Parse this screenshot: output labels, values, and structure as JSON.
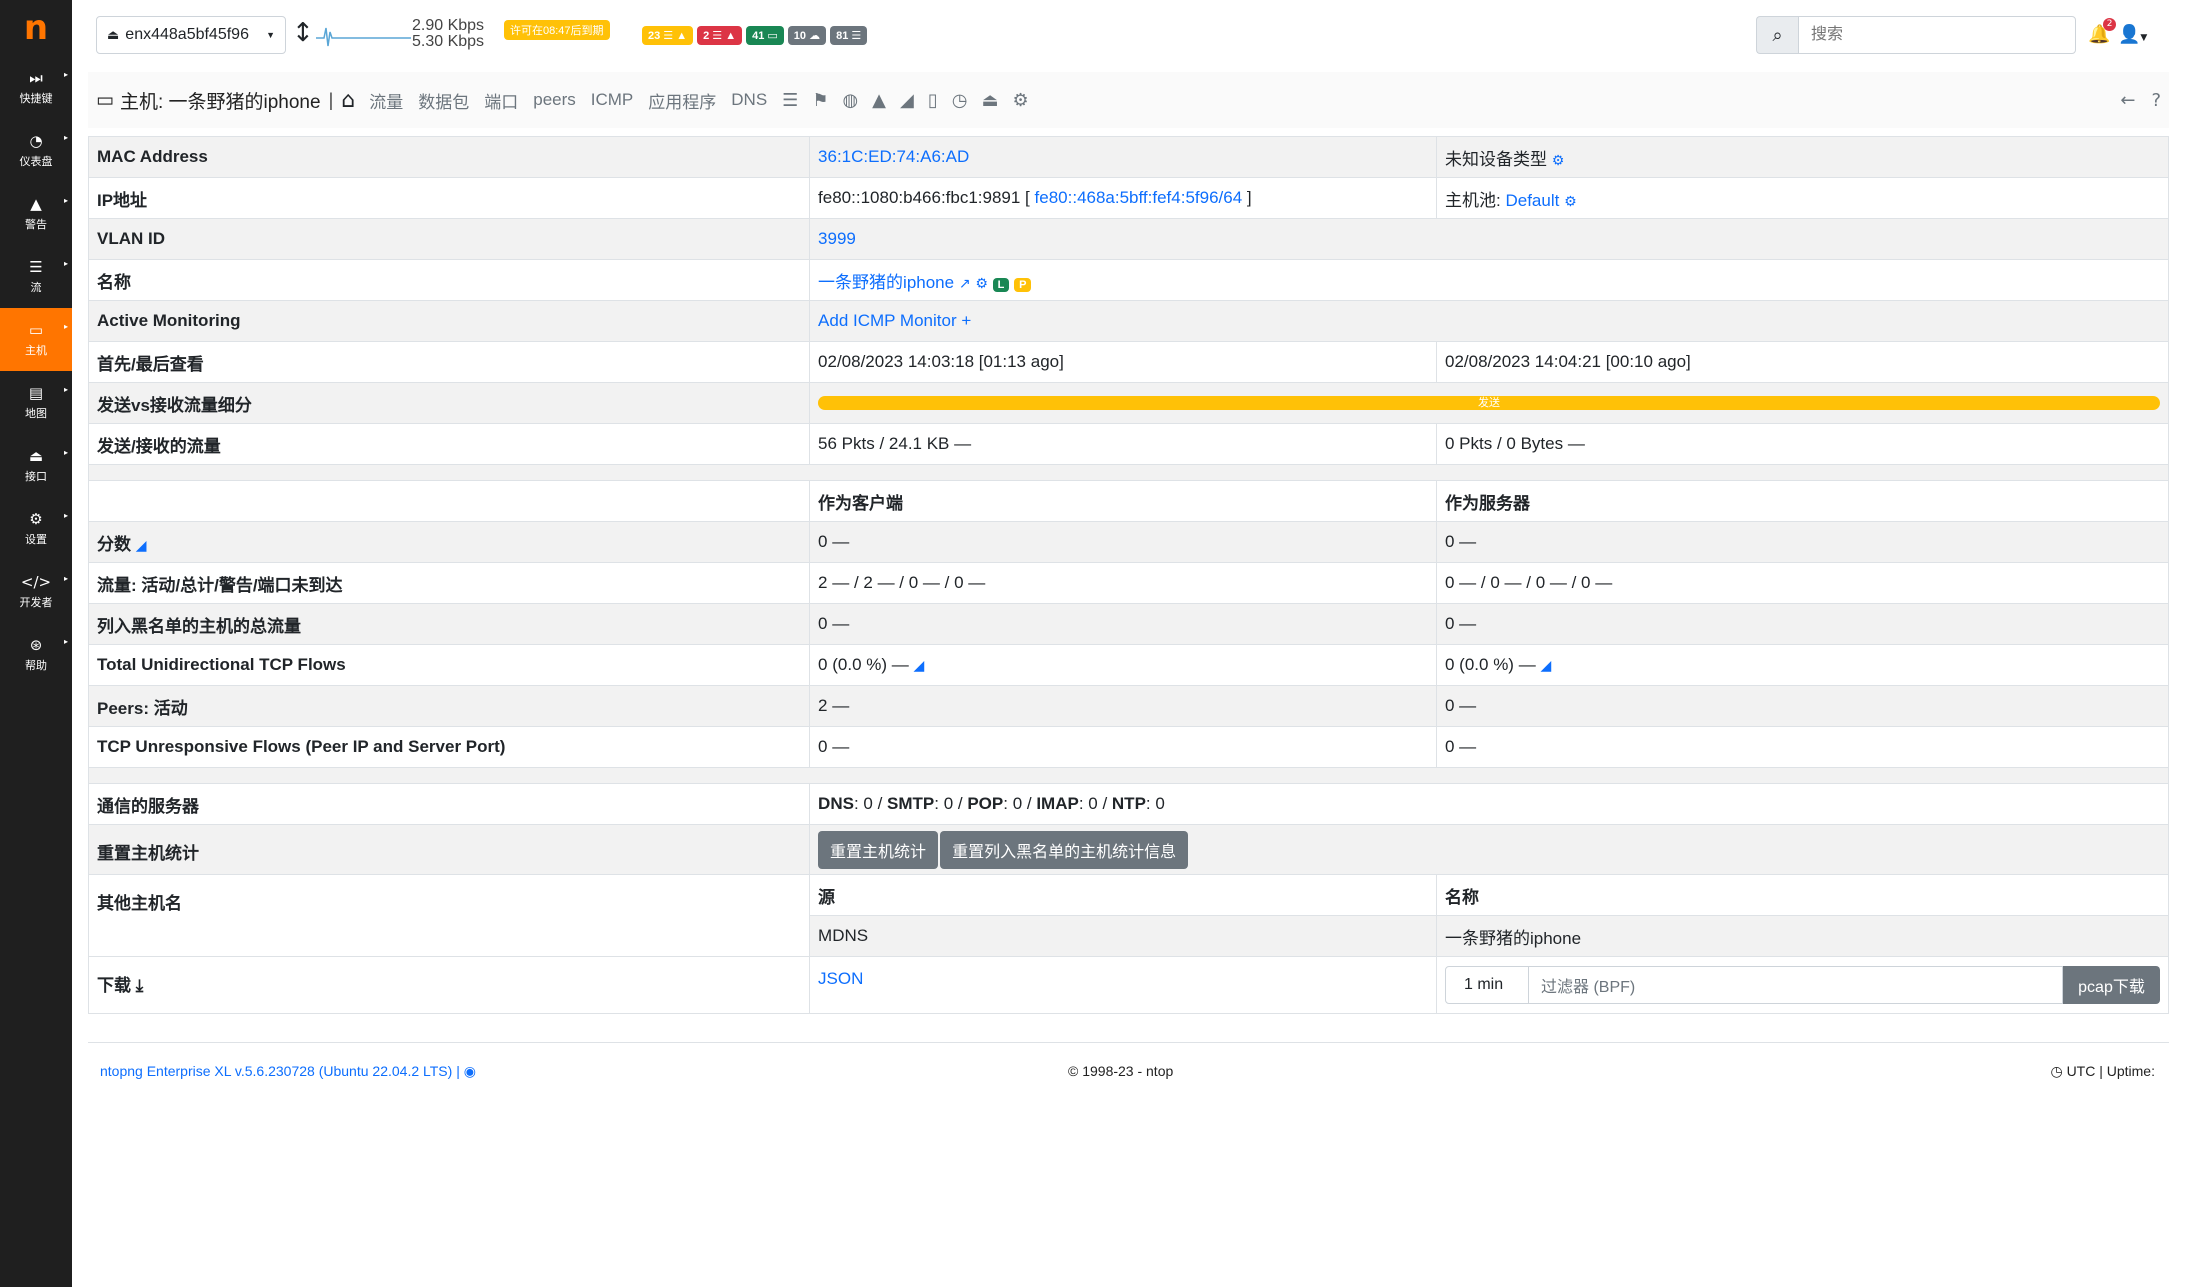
{
  "sidebar": {
    "logo": "n",
    "items": [
      {
        "icon": "fast-forward-icon",
        "glyph": "⏭",
        "label": "快捷键"
      },
      {
        "icon": "dashboard-icon",
        "glyph": "◔",
        "label": "仪表盘"
      },
      {
        "icon": "alert-icon",
        "glyph": "▲",
        "label": "警告"
      },
      {
        "icon": "flows-icon",
        "glyph": "☰",
        "label": "流"
      },
      {
        "icon": "host-icon",
        "glyph": "▭",
        "label": "主机"
      },
      {
        "icon": "map-icon",
        "glyph": "▤",
        "label": "地图"
      },
      {
        "icon": "interface-icon",
        "glyph": "⏏",
        "label": "接口"
      },
      {
        "icon": "settings-icon",
        "glyph": "⚙",
        "label": "设置"
      },
      {
        "icon": "code-icon",
        "glyph": "</>",
        "label": "开发者"
      },
      {
        "icon": "help-icon",
        "glyph": "⊛",
        "label": "帮助"
      }
    ]
  },
  "topbar": {
    "interface": "enx448a5bf45f96",
    "rate_up": "2.90 Kbps",
    "rate_down": "5.30 Kbps",
    "license": "许可在08:47后到期",
    "badges": [
      {
        "text": "23 ☰ ▲",
        "color": "#ffc107"
      },
      {
        "text": "2 ☰ ▲",
        "color": "#dc3545"
      },
      {
        "text": "41 ▭",
        "color": "#198754"
      },
      {
        "text": "10 ☁",
        "color": "#6c757d"
      },
      {
        "text": "81 ☰",
        "color": "#6c757d"
      }
    ],
    "search_placeholder": "搜索",
    "notif_count": "2"
  },
  "hostnav": {
    "title": "主机: 一条野猪的iphone",
    "tabs": [
      "流量",
      "数据包",
      "端口",
      "peers",
      "ICMP",
      "应用程序",
      "DNS"
    ]
  },
  "table": {
    "mac_label": "MAC Address",
    "mac_value": "36:1C:ED:74:A6:AD",
    "device_type": "未知设备类型",
    "ip_label": "IP地址",
    "ip_value": "fe80::1080:b466:fbc1:9891 [",
    "ip_link": "fe80::468a:5bff:fef4:5f96/64",
    "ip_close": "]",
    "pool_label": "主机池:",
    "pool_value": "Default",
    "vlan_label": "VLAN ID",
    "vlan_value": "3999",
    "name_label": "名称",
    "name_value": "一条野猪的iphone",
    "badge_l": "L",
    "badge_p": "P",
    "active_label": "Active Monitoring",
    "active_link": "Add ICMP Monitor +",
    "seen_label": "首先/最后查看",
    "first_seen": "02/08/2023 14:03:18 [01:13 ago]",
    "last_seen": "02/08/2023 14:04:21 [00:10 ago]",
    "breakdown_label": "发送vs接收流量细分",
    "breakdown_bar": "发送",
    "breakdown_sent_pct": 100,
    "traffic_label": "发送/接收的流量",
    "traffic_sent": "56 Pkts / 24.1 KB —",
    "traffic_rcvd": "0 Pkts / 0 Bytes —",
    "as_client": "作为客户端",
    "as_server": "作为服务器",
    "score_label": "分数",
    "score_client": "0 —",
    "score_server": "0 —",
    "flows_label": "流量: 活动/总计/警告/端口未到达",
    "flows_client": "2 — / 2 — / 0 — / 0 —",
    "flows_server": "0 — / 0 — / 0 — / 0 —",
    "blacklist_label": "列入黑名单的主机的总流量",
    "blacklist_client": "0 —",
    "blacklist_server": "0 —",
    "unidir_label": "Total Unidirectional TCP Flows",
    "unidir_client": "0 (0.0 %) —",
    "unidir_server": "0 (0.0 %) —",
    "peers_label": "Peers: 活动",
    "peers_client": "2 —",
    "peers_server": "0 —",
    "unresp_label": "TCP Unresponsive Flows (Peer IP and Server Port)",
    "unresp_client": "0 —",
    "unresp_server": "0 —",
    "servers_label": "通信的服务器",
    "servers_value": [
      {
        "k": "DNS",
        "v": ": 0 / "
      },
      {
        "k": "SMTP",
        "v": ": 0 / "
      },
      {
        "k": "POP",
        "v": ": 0 / "
      },
      {
        "k": "IMAP",
        "v": ": 0 / "
      },
      {
        "k": "NTP",
        "v": ": 0"
      }
    ],
    "reset_label": "重置主机统计",
    "reset_btn": "重置主机统计",
    "reset_blacklist_btn": "重置列入黑名单的主机统计信息",
    "othernames_label": "其他主机名",
    "source_header": "源",
    "name_header": "名称",
    "source_value": "MDNS",
    "othername_value": "一条野猪的iphone",
    "download_label": "下载",
    "download_json": "JSON",
    "dl_duration": "1 min",
    "dl_filter_placeholder": "过滤器 (BPF)",
    "dl_btn": "pcap下载"
  },
  "footer": {
    "version": "ntopng Enterprise XL v.5.6.230728 (Ubuntu 22.04.2 LTS) |",
    "copyright": "© 1998-23 - ntop",
    "uptime": "UTC | Uptime:"
  }
}
